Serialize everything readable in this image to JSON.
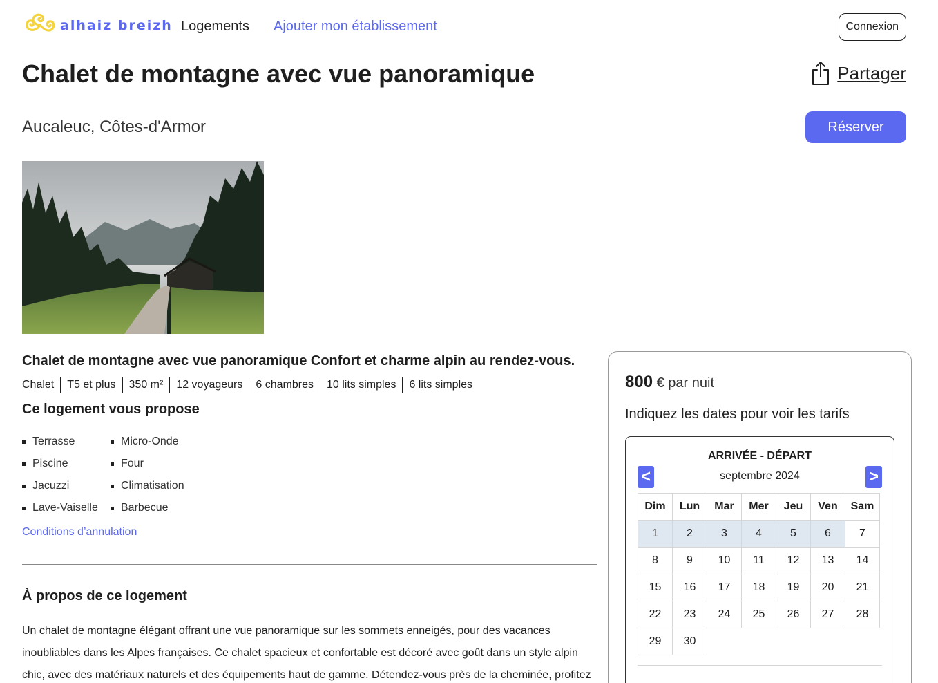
{
  "header": {
    "brand": "alhaiz breizh",
    "nav_logements": "Logements",
    "nav_ajouter": "Ajouter mon établissement",
    "login_label": "Connexion",
    "logo_color": "#f5d33b",
    "accent": "#5b68f0"
  },
  "listing": {
    "title": "Chalet de montagne avec vue panoramique",
    "share_label": "Partager",
    "location": "Aucaleuc, Côtes-d'Armor",
    "reserve_label": "Réserver",
    "subtitle": "Chalet de montagne avec vue panoramique Confort et charme alpin au rendez-vous.",
    "tags": [
      "Chalet",
      "T5 et plus",
      "350 m²",
      "12 voyageurs",
      "6 chambres",
      "10 lits simples",
      "6 lits simples"
    ],
    "propose_title": "Ce logement vous propose",
    "amenities_col1": [
      "Terrasse",
      "Piscine",
      "Jacuzzi",
      "Lave-Vaiselle"
    ],
    "amenities_col2": [
      "Micro-Onde",
      "Four",
      "Climatisation",
      "Barbecue"
    ],
    "cancel_link": "Conditions d’annulation",
    "about_title": "À propos de ce logement",
    "about_text": "Un chalet de montagne élégant offrant une vue panoramique sur les sommets enneigés, pour des vacances inoubliables dans les Alpes françaises. Ce chalet spacieux et confortable est décoré avec goût dans un style alpin chic, avec des matériaux naturels et des équipements haut de gamme. Détendez-vous près de la cheminée, profitez"
  },
  "booking": {
    "price_amount": "800",
    "price_unit": "€ par nuit",
    "hint": "Indiquez les dates pour voir les tarifs",
    "calendar": {
      "heading": "ARRIVÉE - DÉPART",
      "month": "septembre 2024",
      "prev": "<",
      "next": ">",
      "weekdays": [
        "Dim",
        "Lun",
        "Mar",
        "Mer",
        "Jeu",
        "Ven",
        "Sam"
      ],
      "weeks": [
        [
          "1",
          "2",
          "3",
          "4",
          "5",
          "6",
          "7"
        ],
        [
          "8",
          "9",
          "10",
          "11",
          "12",
          "13",
          "14"
        ],
        [
          "15",
          "16",
          "17",
          "18",
          "19",
          "20",
          "21"
        ],
        [
          "22",
          "23",
          "24",
          "25",
          "26",
          "27",
          "28"
        ],
        [
          "29",
          "30",
          "",
          "",
          "",
          "",
          ""
        ]
      ],
      "highlighted_days": [
        "1",
        "2",
        "3",
        "4",
        "5",
        "6"
      ],
      "highlight_color": "#dfe8f1"
    }
  }
}
